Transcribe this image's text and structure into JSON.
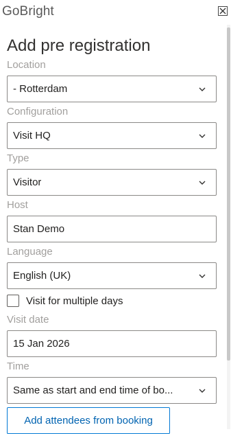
{
  "app": {
    "title": "GoBright",
    "close_icon": "close-icon"
  },
  "page": {
    "title": "Add pre registration"
  },
  "fields": {
    "location": {
      "label": "Location",
      "value": "- Rotterdam"
    },
    "configuration": {
      "label": "Configuration",
      "value": "Visit HQ"
    },
    "type": {
      "label": "Type",
      "value": "Visitor"
    },
    "host": {
      "label": "Host",
      "value": "Stan Demo"
    },
    "language": {
      "label": "Language",
      "value": "English (UK)"
    },
    "multiple_days": {
      "label": "Visit for multiple days",
      "checked": false
    },
    "visit_date": {
      "label": "Visit date",
      "value": "15 Jan 2026"
    },
    "time": {
      "label": "Time",
      "value": "Same as start and end time of bo..."
    }
  },
  "actions": {
    "add_attendees_label": "Add attendees from booking"
  },
  "colors": {
    "accent": "#0078d4",
    "label": "#a19f9d",
    "border": "#8a8886"
  }
}
